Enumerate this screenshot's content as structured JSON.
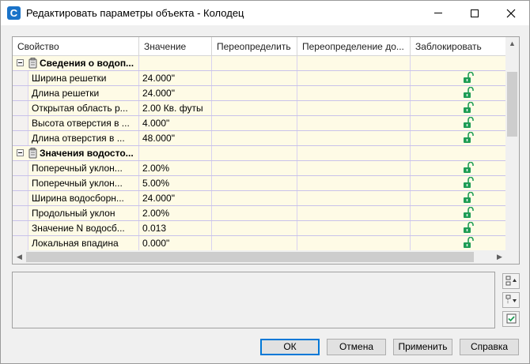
{
  "window": {
    "title": "Редактировать параметры объекта - Колодец",
    "app_icon_letter": "C"
  },
  "grid": {
    "columns": [
      "Свойство",
      "Значение",
      "Переопределить",
      "Переопределение до...",
      "Заблокировать"
    ],
    "rows": [
      {
        "type": "category",
        "label": "Сведения о водоп..."
      },
      {
        "type": "item",
        "label": "Ширина решетки",
        "value": "24.000\"",
        "locked": true
      },
      {
        "type": "item",
        "label": "Длина решетки",
        "value": "24.000\"",
        "locked": true
      },
      {
        "type": "item",
        "label": "Открытая область р...",
        "value": "2.00 Кв. футы",
        "locked": true
      },
      {
        "type": "item",
        "label": "Высота отверстия в ...",
        "value": "4.000\"",
        "locked": true
      },
      {
        "type": "item",
        "label": "Длина отверстия в ...",
        "value": "48.000\"",
        "locked": true
      },
      {
        "type": "category",
        "label": "Значения водосто..."
      },
      {
        "type": "item",
        "label": "Поперечный уклон...",
        "value": "2.00%",
        "locked": true
      },
      {
        "type": "item",
        "label": "Поперечный уклон...",
        "value": "5.00%",
        "locked": true
      },
      {
        "type": "item",
        "label": "Ширина водосборн...",
        "value": "24.000\"",
        "locked": true
      },
      {
        "type": "item",
        "label": "Продольный уклон",
        "value": "2.00%",
        "locked": true
      },
      {
        "type": "item",
        "label": "Значение N водосб...",
        "value": "0.013",
        "locked": true
      },
      {
        "type": "item",
        "label": "Локальная впадина",
        "value": "0.000\"",
        "locked": true
      }
    ]
  },
  "buttons": {
    "ok": "ОК",
    "cancel": "Отмена",
    "apply": "Применить",
    "help": "Справка"
  },
  "side_buttons": [
    {
      "name": "expand-all-icon"
    },
    {
      "name": "collapse-all-icon"
    },
    {
      "name": "checkbox-icon"
    }
  ],
  "colors": {
    "cell_background": "#fefbe6",
    "row_separator": "#c9c2ea",
    "lock_green": "#1f9d55",
    "primary_border": "#0078d7"
  }
}
